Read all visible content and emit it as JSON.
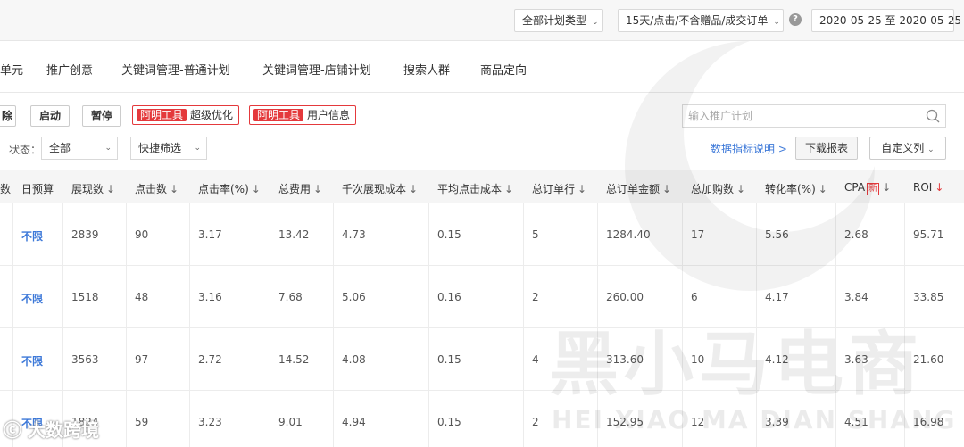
{
  "topbar": {
    "plan_type": "全部计划类型",
    "attribution": "15天/点击/不含赠品/成交订单",
    "date_range": "2020-05-25 至 2020-05-25"
  },
  "tabs": [
    "单元",
    "推广创意",
    "关键词管理-普通计划",
    "关键词管理-店铺计划",
    "搜索人群",
    "商品定向"
  ],
  "toolbar": {
    "delete_label": "除",
    "start_label": "启动",
    "pause_label": "暂停",
    "tool1_badge": "阿明工具",
    "tool1_label": "超级优化",
    "tool2_badge": "阿明工具",
    "tool2_label": "用户信息",
    "search_placeholder": "输入推广计划",
    "state_label": "状态：",
    "state_value": "全部",
    "quick_filter": "快捷筛选",
    "metric_link": "数据指标说明 >",
    "download_label": "下载报表",
    "custom_columns": "自定义列"
  },
  "table": {
    "headers": [
      "数",
      "日预算",
      "展现数",
      "点击数",
      "点击率(%)",
      "总费用",
      "千次展现成本",
      "平均点击成本",
      "总订单行",
      "总订单金额",
      "总加购数",
      "转化率(%)",
      "CPA",
      "ROI"
    ],
    "new_badge": "新",
    "rows": [
      [
        "不限",
        "2839",
        "90",
        "3.17",
        "13.42",
        "4.73",
        "0.15",
        "5",
        "1284.40",
        "17",
        "5.56",
        "2.68",
        "95.71"
      ],
      [
        "不限",
        "1518",
        "48",
        "3.16",
        "7.68",
        "5.06",
        "0.16",
        "2",
        "260.00",
        "6",
        "4.17",
        "3.84",
        "33.85"
      ],
      [
        "不限",
        "3563",
        "97",
        "2.72",
        "14.52",
        "4.08",
        "0.15",
        "4",
        "313.60",
        "10",
        "4.12",
        "3.63",
        "21.60"
      ],
      [
        "不限",
        "1824",
        "59",
        "3.23",
        "9.01",
        "4.94",
        "0.15",
        "2",
        "152.95",
        "12",
        "3.39",
        "4.51",
        "16.98"
      ]
    ]
  },
  "watermark": {
    "cn": "黑小马电商",
    "en": "HEI XIAO MA DIAN SHANG",
    "logo": "大数跨境"
  }
}
